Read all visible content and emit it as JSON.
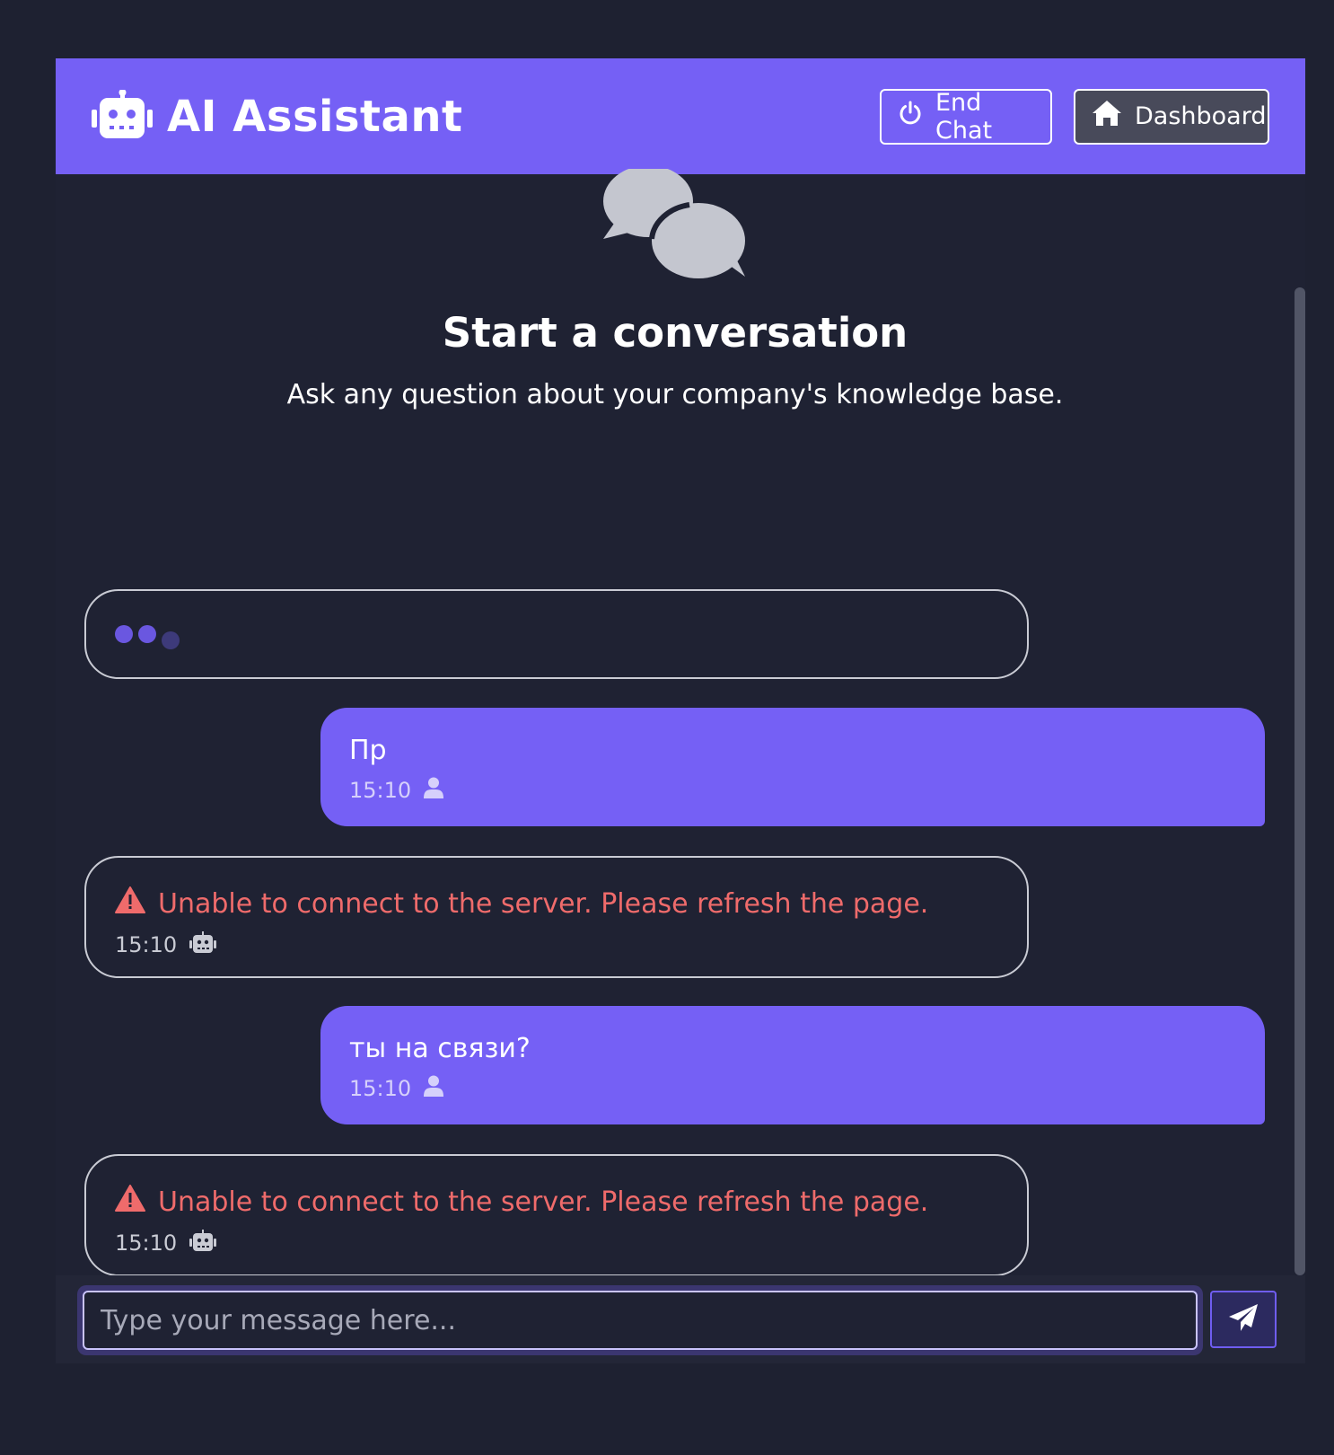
{
  "header": {
    "title": "AI Assistant",
    "logo_icon": "robot-icon",
    "end_chat_label": "End Chat",
    "end_chat_icon": "power-icon",
    "dashboard_label": "Dashboard",
    "dashboard_icon": "home-icon"
  },
  "empty_state": {
    "icon": "comments-icon",
    "title": "Start a conversation",
    "subtitle": "Ask any question about your company's knowledge base."
  },
  "messages": [
    {
      "role": "bot",
      "type": "typing"
    },
    {
      "role": "user",
      "text": "Пр",
      "time": "15:10",
      "icon": "user-icon"
    },
    {
      "role": "bot",
      "type": "error",
      "text": "Unable to connect to the server. Please refresh the page.",
      "time": "15:10",
      "icon": "robot-icon"
    },
    {
      "role": "user",
      "text": "ты на связи?",
      "time": "15:10",
      "icon": "user-icon"
    },
    {
      "role": "bot",
      "type": "error",
      "text": "Unable to connect to the server. Please refresh the page.",
      "time": "15:10",
      "icon": "robot-icon"
    }
  ],
  "composer": {
    "placeholder": "Type your message here...",
    "value": "",
    "send_icon": "paper-plane-icon"
  },
  "colors": {
    "background": "#1e2131",
    "accent": "#7560f5",
    "error": "#ef6b6b"
  }
}
